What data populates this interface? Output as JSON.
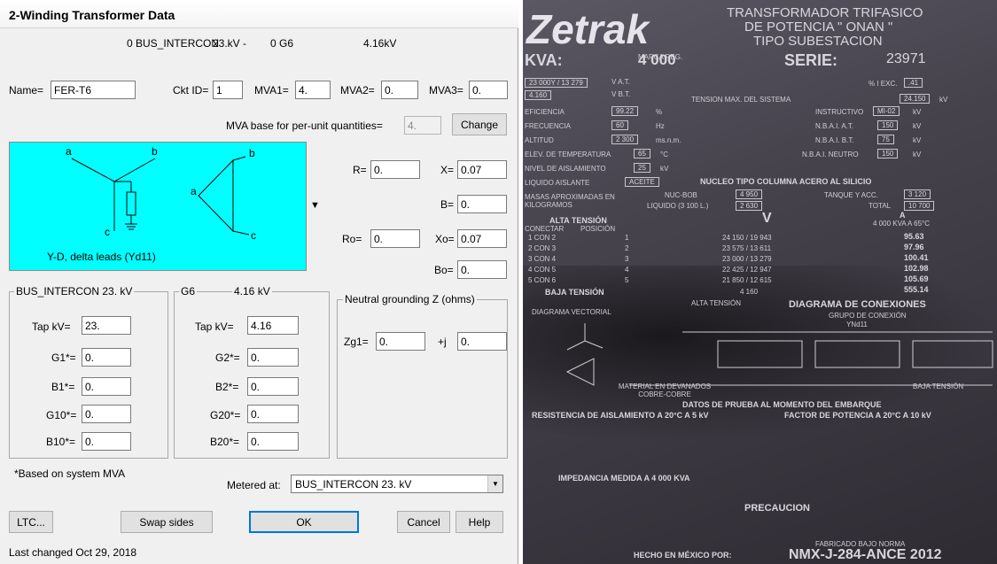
{
  "dialog": {
    "title": "2-Winding Transformer Data",
    "header": {
      "bus1": "0 BUS_INTERCON",
      "bus1_kv": "23.kV -",
      "bus2": "0 G6",
      "bus2_kv": "4.16kV"
    },
    "name_label": "Name=",
    "name_value": "FER-T6",
    "ckt_label": "Ckt ID=",
    "ckt_value": "1",
    "mva1_label": "MVA1=",
    "mva1_value": "4.",
    "mva2_label": "MVA2=",
    "mva2_value": "0.",
    "mva3_label": "MVA3=",
    "mva3_value": "0.",
    "mva_base_label": "MVA base for per-unit quantities=",
    "mva_base_value": "4.",
    "change_button": "Change",
    "diagram": {
      "label_a1": "a",
      "label_b1": "b",
      "label_c1": "c",
      "label_a2": "a",
      "label_b2": "b",
      "label_c2": "c",
      "caption": "Y-D, delta leads (Yd11)"
    },
    "impedance": {
      "r_label": "R=",
      "r_value": "0.",
      "x_label": "X=",
      "x_value": "0.07",
      "b_label": "B=",
      "b_value": "0.",
      "ro_label": "Ro=",
      "ro_value": "0.",
      "xo_label": "Xo=",
      "xo_value": "0.07",
      "bo_label": "Bo=",
      "bo_value": "0."
    },
    "group1": {
      "title": "BUS_INTERCON 23.  kV",
      "tap_label": "Tap kV=",
      "tap_value": "23.",
      "g1_label": "G1*=",
      "g1_value": "0.",
      "b1_label": "B1*=",
      "b1_value": "0.",
      "g10_label": "G10*=",
      "g10_value": "0.",
      "b10_label": "B10*=",
      "b10_value": "0."
    },
    "group2": {
      "title_name": "G6",
      "title_kv": "4.16 kV",
      "tap_label": "Tap kV=",
      "tap_value": "4.16",
      "g2_label": "G2*=",
      "g2_value": "0.",
      "b2_label": "B2*=",
      "b2_value": "0.",
      "g20_label": "G20*=",
      "g20_value": "0.",
      "b20_label": "B20*=",
      "b20_value": "0."
    },
    "neutral": {
      "title": "Neutral grounding Z (ohms)",
      "zg1_label": "Zg1=",
      "zg1_value": "0.",
      "j_label": "+j",
      "zg1_imag": "0."
    },
    "footnote": "*Based on system MVA",
    "metered_label": "Metered at:",
    "metered_value": "BUS_INTERCON 23.  kV",
    "buttons": {
      "ltc": "LTC...",
      "swap": "Swap sides",
      "ok": "OK",
      "cancel": "Cancel",
      "help": "Help"
    },
    "last_changed": "Last changed Oct 29, 2018"
  },
  "photo": {
    "brand": "Zetrak",
    "marca": "MARCA REG.",
    "heading1": "TRANSFORMADOR TRIFASICO",
    "heading2": "DE POTENCIA \" ONAN \"",
    "heading3": "TIPO SUBESTACION",
    "kva_label": "KVA:",
    "kva_value": "4 000",
    "serie_label": "SERIE:",
    "serie_value": "23971",
    "vat": "23 000Y / 13 279",
    "vat_label": "V A.T.",
    "vbt": "4.160",
    "vbt_label": "V B.T.",
    "iexc_label": "% I EXC.",
    "iexc_value": ".41",
    "tension_label": "TENSION MAX. DEL SISTEMA",
    "tension_value": "24.150",
    "tension_unit": "kV",
    "eficiencia_label": "EFICIENCIA",
    "eficiencia_value": "99.22",
    "eficiencia_unit": "%",
    "instructivo_label": "INSTRUCTIVO",
    "instructivo_value": "MI-02",
    "instructivo_unit": "kV",
    "frecuencia_label": "FRECUENCIA",
    "frecuencia_value": "60",
    "frecuencia_unit": "Hz",
    "nbai_at_label": "N.B.A.I. A.T.",
    "nbai_at_value": "150",
    "nbai_at_unit": "kV",
    "altitud_label": "ALTITUD",
    "altitud_value": "2 300",
    "altitud_unit": "ms.n.m.",
    "nbai_bt_label": "N.B.A.I. B.T.",
    "nbai_bt_value": "75",
    "nbai_bt_unit": "kV",
    "elev_label": "ELEV. DE TEMPERATURA",
    "elev_value": "65",
    "elev_unit": "°C",
    "nbai_n_label": "N.B.A.I. NEUTRO",
    "nbai_n_value": "150",
    "nbai_n_unit": "kV",
    "nivel_label": "NIVEL DE AISLAMIENTO",
    "nivel_value": "25",
    "nivel_unit": "kV",
    "liquido_label": "LIQUIDO AISLANTE",
    "liquido_value": "ACEITE",
    "nucleo": "NUCLEO TIPO COLUMNA ACERO AL SILICIO",
    "masas_label": "MASAS APROXIMADAS EN KILOGRAMOS",
    "nucbob_label": "NUC-BOB",
    "nucbob_value": "4 950",
    "tanque_label": "TANQUE Y ACC.",
    "tanque_value": "3 120",
    "liquido_l_label": "LIQUIDO (3 100 L.)",
    "liquido_l_value": "2 630",
    "total_label": "TOTAL",
    "total_value": "10 700",
    "alta_tension": "ALTA TENSIÓN",
    "conectar": "CONECTAR",
    "posicion": "POSICIÓN",
    "col_v": "V",
    "col_a": "A",
    "col_a_sub": "4 000 KVA A 65°C",
    "taps": [
      {
        "con": "1 CON 2",
        "pos": "1",
        "v": "24 150 / 19 943",
        "a": "95.63"
      },
      {
        "con": "2 CON 3",
        "pos": "2",
        "v": "23 575 / 13 611",
        "a": "97.96"
      },
      {
        "con": "3 CON 4",
        "pos": "3",
        "v": "23 000 / 13 279",
        "a": "100.41"
      },
      {
        "con": "4 CON 5",
        "pos": "4",
        "v": "22 425 / 12 947",
        "a": "102.98"
      },
      {
        "con": "5 CON 6",
        "pos": "5",
        "v": "21 850 / 12 615",
        "a": "105.69"
      }
    ],
    "baja_tension": "BAJA TENSIÓN",
    "baja_v": "4 160",
    "baja_a": "555.14",
    "diag_conex": "DIAGRAMA DE CONEXIONES",
    "grupo_conex": "GRUPO DE CONEXIÓN",
    "grupo_value": "YNd11",
    "diag_vect": "DIAGRAMA VECTORIAL",
    "alta_tension2": "ALTA TENSIÓN",
    "material": "MATERIAL EN DEVANADOS COBRE-COBRE",
    "baja_tension2": "BAJA TENSIÓN",
    "datos_prueba": "DATOS DE PRUEBA AL MOMENTO DEL EMBARQUE",
    "resistencia": "RESISTENCIA DE AISLAMIENTO A 20°C A 5 kV",
    "factor": "FACTOR DE POTENCIA A 20°C A 10 kV",
    "impedancia": "IMPEDANCIA MEDIDA A 4 000 KVA",
    "precaucion": "PRECAUCION",
    "fabricado": "FABRICADO BAJO NORMA",
    "hecho": "HECHO EN MÉXICO POR:",
    "norma": "NMX-J-284-ANCE 2012"
  }
}
